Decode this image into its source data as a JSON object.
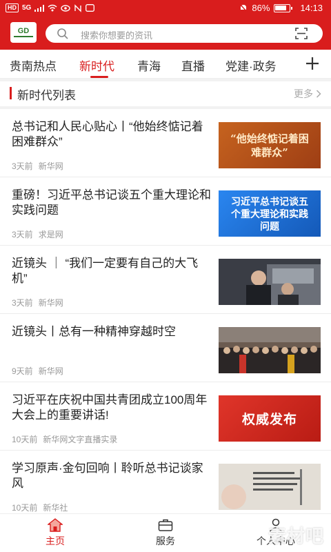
{
  "status_bar": {
    "network": "HD",
    "signal": "5G",
    "battery": "86%",
    "time": "14:13"
  },
  "header": {
    "logo_label": "GD",
    "search_placeholder": "搜索你想要的资讯"
  },
  "tabs": [
    {
      "label": "贵南热点",
      "active": false
    },
    {
      "label": "新时代",
      "active": true
    },
    {
      "label": "青海",
      "active": false
    },
    {
      "label": "直播",
      "active": false
    },
    {
      "label": "党建·政务",
      "active": false
    }
  ],
  "section": {
    "title": "新时代列表",
    "more_label": "更多"
  },
  "articles": [
    {
      "title": "总书记和人民心贴心丨“他始终惦记着困难群众”",
      "time": "3天前",
      "source": "新华网",
      "thumb_text": "“他始终惦记着困难群众”",
      "thumb_color": "#b8551c"
    },
    {
      "title": "重磅！习近平总书记谈五个重大理论和实践问题",
      "time": "3天前",
      "source": "求是网",
      "thumb_text": "习近平总书记谈五个重大理论和实践问题",
      "thumb_color": "#1f73d8"
    },
    {
      "title": "近镜头 ｜ “我们一定要有自己的大飞机”",
      "time": "3天前",
      "source": "新华网",
      "thumb_text": "",
      "thumb_color": "#3a3d45"
    },
    {
      "title": "近镜头丨总有一种精神穿越时空",
      "time": "9天前",
      "source": "新华网",
      "thumb_text": "",
      "thumb_color": "#5a4b44"
    },
    {
      "title": "习近平在庆祝中国共青团成立100周年大会上的重要讲话!",
      "time": "10天前",
      "source": "新华网文字直播实录",
      "thumb_text": "权威发布",
      "thumb_color": "#d92a20"
    },
    {
      "title": "学习原声·金句回响丨聆听总书记谈家风",
      "time": "10天前",
      "source": "新华社",
      "thumb_text": "",
      "thumb_color": "#d9d4cc"
    }
  ],
  "bottom_nav": [
    {
      "label": "主页",
      "icon": "home-icon",
      "active": true
    },
    {
      "label": "服务",
      "icon": "briefcase-icon",
      "active": false
    },
    {
      "label": "个人中心",
      "icon": "person-icon",
      "active": false
    }
  ],
  "watermark": "素材吧",
  "colors": {
    "brand_red": "#d91d1d",
    "divider": "#f2f2f2"
  }
}
